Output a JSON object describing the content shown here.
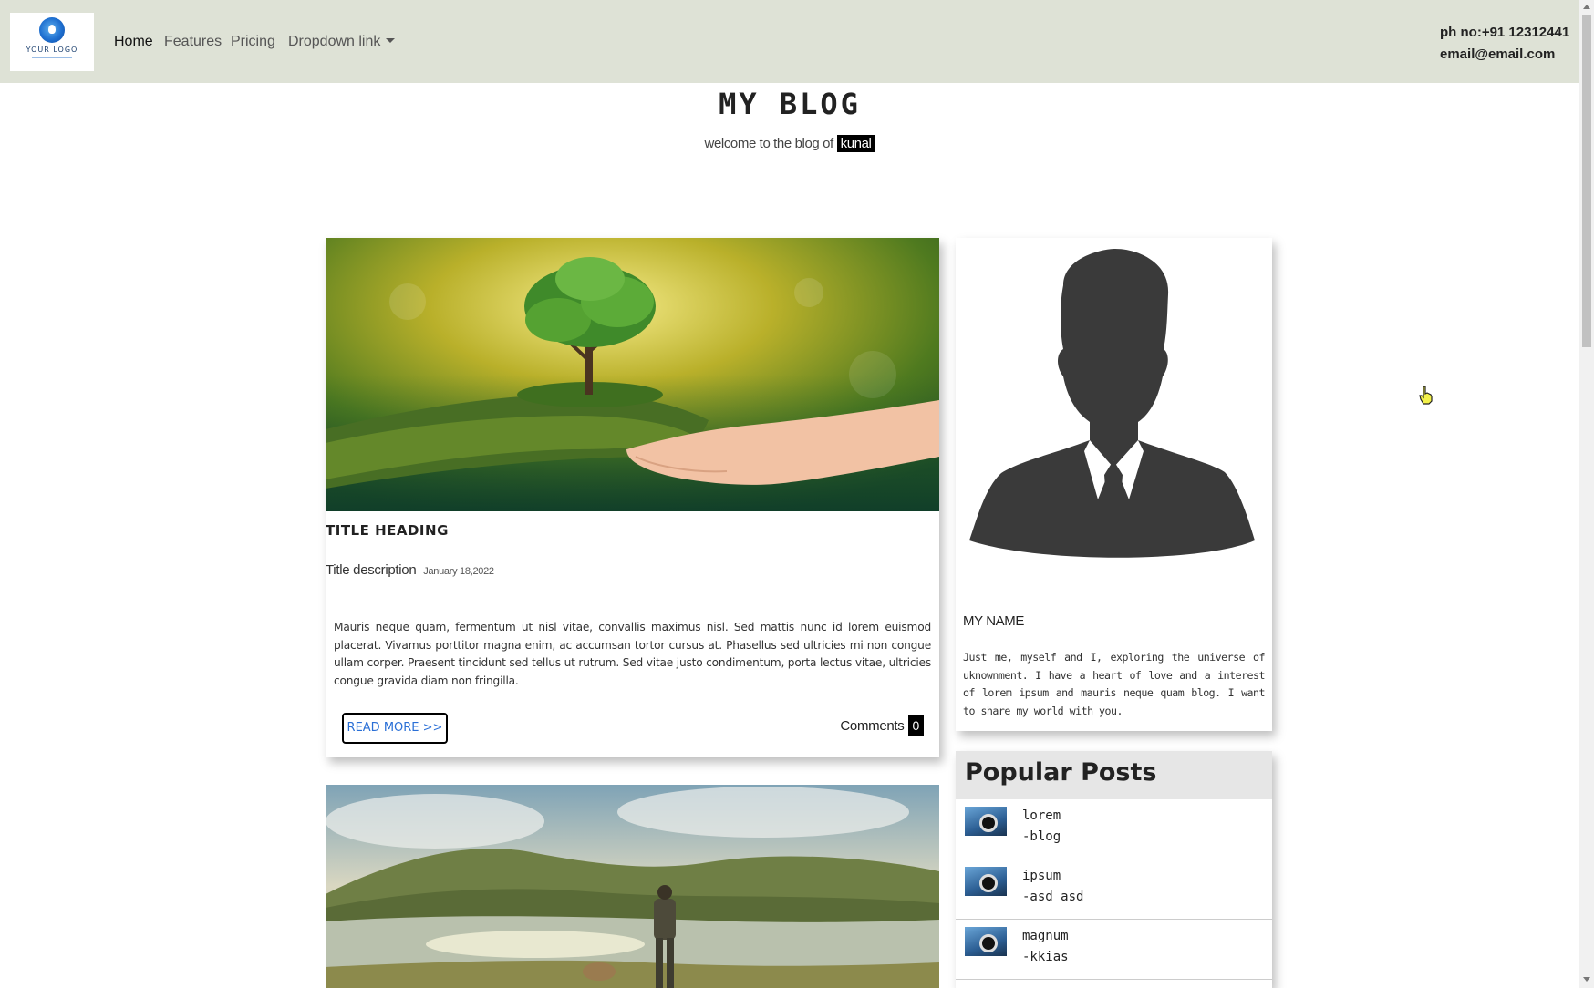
{
  "nav": {
    "logo_text": "YOUR LOGO",
    "links": [
      "Home",
      "Features",
      "Pricing",
      "Dropdown link"
    ],
    "phone": "ph no:+91 12312441",
    "email": "email@email.com"
  },
  "header": {
    "title": "MY BLOG",
    "tagline_prefix": "welcome to the blog of",
    "tagline_name": "kunal"
  },
  "post": {
    "heading": "TITLE HEADING",
    "description": "Title description",
    "date": "January 18,2022",
    "body": "Mauris neque quam, fermentum ut nisl vitae, convallis maximus nisl. Sed mattis nunc id lorem euismod placerat. Vivamus porttitor magna enim, ac accumsan tortor cursus at. Phasellus sed ultricies mi non congue ullam corper. Praesent tincidunt sed tellus ut rutrum. Sed vitae justo condimentum, porta lectus vitae, ultricies congue gravida diam non fringilla.",
    "read_more": "READ MORE >>",
    "comments_label": "Comments",
    "comments_count": "0"
  },
  "profile": {
    "name": "MY NAME",
    "bio": "Just me, myself and I, exploring the universe of uknownment. I have a heart of love and a interest of lorem ipsum and mauris neque quam blog. I want to share my world with you."
  },
  "popular": {
    "title": "Popular Posts",
    "items": [
      {
        "name": "lorem",
        "sub": "-blog"
      },
      {
        "name": "ipsum",
        "sub": "-asd asd"
      },
      {
        "name": "magnum",
        "sub": "-kkias"
      }
    ]
  },
  "icons": [
    "logo-icon",
    "caret-down-icon",
    "profile-silhouette",
    "hand-cursor-icon"
  ],
  "colors": {
    "navbar_bg": "#dee2d6",
    "link_blue": "#2a6fd6",
    "badge_bg": "#000000"
  }
}
